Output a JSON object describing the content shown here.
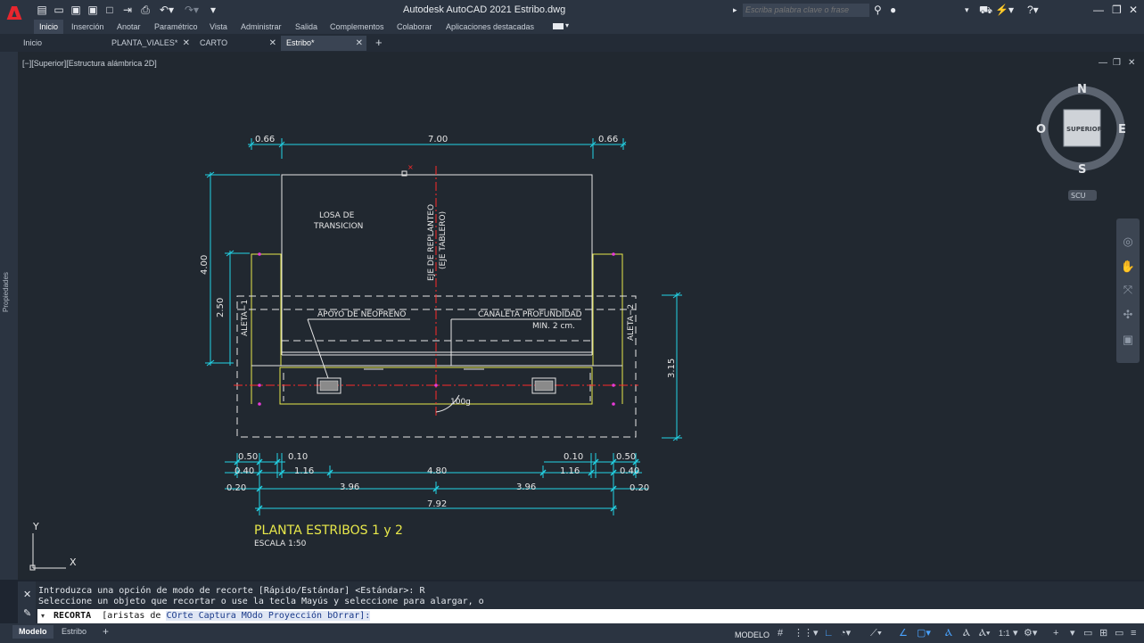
{
  "app": {
    "title": "Autodesk AutoCAD 2021    Estribo.dwg",
    "logo_letter": "A"
  },
  "search": {
    "placeholder": "Escriba palabra clave o frase"
  },
  "ribbon_tabs": [
    "Inicio",
    "Inserción",
    "Anotar",
    "Paramétrico",
    "Vista",
    "Administrar",
    "Salida",
    "Complementos",
    "Colaborar",
    "Aplicaciones destacadas"
  ],
  "file_tabs": [
    {
      "label": "Inicio",
      "closable": false
    },
    {
      "label": "PLANTA_VIALES*",
      "closable": true
    },
    {
      "label": "CARTO",
      "closable": true
    },
    {
      "label": "Estribo*",
      "closable": true
    }
  ],
  "left_panel": {
    "label": "Propiedades"
  },
  "viewport": {
    "label": "[−][Superior][Estructura alámbrica 2D]",
    "viewcube": {
      "n": "N",
      "s": "S",
      "e": "E",
      "w": "O",
      "face": "SUPERIOR",
      "ucs": "SCU"
    }
  },
  "drawing": {
    "top_dims": [
      "0.66",
      "7.00",
      "0.66"
    ],
    "left_dims": [
      "4.00",
      "2.50"
    ],
    "right_dim": "3.15",
    "labels": {
      "losa": [
        "LOSA DE",
        "TRANSICION"
      ],
      "eje": [
        "EJE DE REPLANTEO",
        "(EJE TABLERO)"
      ],
      "aleta1": "ALETA−1",
      "aleta2": "ALETA−2",
      "apoyo": "APOYO DE NEOPRENO",
      "canaleta": [
        "CANALETA PROFUNDIDAD",
        "MIN. 2 cm."
      ],
      "angle": "100g"
    },
    "bottom_dims": {
      "row1": [
        "0.50",
        "0.10",
        "0.10",
        "0.50"
      ],
      "row2": [
        "0.40",
        "1.16",
        "4.80",
        "1.16",
        "0.40"
      ],
      "row3": [
        "0.20",
        "3.96",
        "3.96",
        "0.20"
      ],
      "row4": [
        "7.92"
      ]
    },
    "title": "PLANTA  ESTRIBOS  1  y  2",
    "scale": "ESCALA  1:50",
    "axis_x": "X",
    "axis_y": "Y"
  },
  "command": {
    "line1": "Introduzca una opción de modo de recorte [Rápido/Estándar] <Estándar>: R",
    "line2": "Seleccione un objeto que recortar o use la tecla Mayús y seleccione para alargar, o",
    "prompt_cmd": "RECORTA",
    "prompt_options": [
      "[aristas de ",
      "CO",
      "rte ",
      "Captura ",
      "MO",
      "do ",
      "Proyección ",
      "bO",
      "rrar]:"
    ]
  },
  "status": {
    "tabs": [
      "Modelo",
      "Estribo"
    ],
    "model_label": "MODELO",
    "scale": "1:1"
  },
  "colors": {
    "dim": "#22d3e6",
    "yellow": "#e8e84a",
    "white": "#e6e6e6",
    "red": "#ff2a2a",
    "magenta": "#e83ad8"
  }
}
